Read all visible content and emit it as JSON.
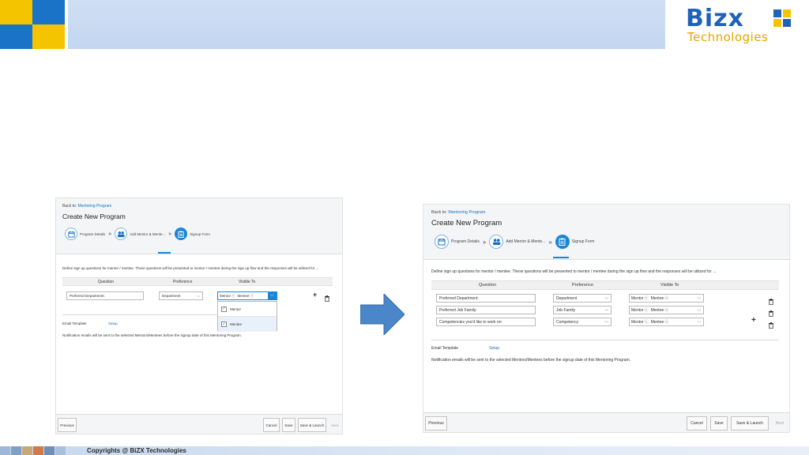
{
  "brand": {
    "name": "Bizx",
    "tagline": "Technologies"
  },
  "footer": {
    "copyright": "Copyrights @ BiZX Technologies"
  },
  "colors": {
    "accent": "#1a86d6",
    "link": "#1a6fbf",
    "brand_blue": "#1f63b8",
    "brand_yellow": "#f5c400",
    "arrow": "#4a86c8"
  },
  "left_screen": {
    "back_label": "Back to:",
    "back_link": "Mentoring Program",
    "title": "Create New Program",
    "steps": [
      {
        "label": "Program Details",
        "icon": "calendar-icon"
      },
      {
        "label": "Add Mentor & Mente...",
        "icon": "users-icon"
      },
      {
        "label": "Signup Form",
        "icon": "clipboard-icon"
      }
    ],
    "description": "Define sign up questions for mentor / mentee. These questions will be presented to mentor / mentee during the sign up flow and the responses will be utilized for ...",
    "headers": {
      "question": "Question",
      "preference": "Preference",
      "visible_to": "Visible To"
    },
    "rows": [
      {
        "question": "Preferred Department:",
        "preference": "Department",
        "visible": [
          "Mentor",
          "Mentee"
        ]
      }
    ],
    "dropdown_options": [
      "Mentor",
      "Mentee"
    ],
    "email_template_label": "Email Template",
    "setup_link": "Setup",
    "notification": "Notification emails will be sent to the selected Mentors/Mentees before the signup date of this Mentoring Program.",
    "buttons": {
      "previous": "Previous",
      "cancel": "Cancel",
      "save": "Save",
      "save_launch": "Save & Launch",
      "next": "Next"
    }
  },
  "right_screen": {
    "back_label": "Back to:",
    "back_link": "Mentoring Program",
    "title": "Create New Program",
    "steps": [
      {
        "label": "Program Details",
        "icon": "calendar-icon"
      },
      {
        "label": "Add Mentor & Mente...",
        "icon": "users-icon"
      },
      {
        "label": "Signup Form",
        "icon": "clipboard-icon"
      }
    ],
    "description": "Define sign up questions for mentor / mentee. These questions will be presented to mentor / mentee during the sign up flow and the responses will be utilized for ...",
    "headers": {
      "question": "Question",
      "preference": "Preference",
      "visible_to": "Visible To"
    },
    "rows": [
      {
        "question": "Preferred Department:",
        "preference": "Department",
        "visible": [
          "Mentor",
          "Mentee"
        ]
      },
      {
        "question": "Preferred Job Family:",
        "preference": "Job Family",
        "visible": [
          "Mentor",
          "Mentee"
        ]
      },
      {
        "question": "Competencies you'd like to work on:",
        "preference": "Competency",
        "visible": [
          "Mentor",
          "Mentee"
        ]
      }
    ],
    "email_template_label": "Email Template",
    "setup_link": "Setup",
    "notification": "Notification emails will be sent to the selected Mentors/Mentees before the signup date of this Mentoring Program.",
    "buttons": {
      "previous": "Previous",
      "cancel": "Cancel",
      "save": "Save",
      "save_launch": "Save & Launch",
      "next": "Next"
    }
  },
  "icons": {
    "add": "plus-icon",
    "delete": "trash-icon",
    "remove_token": "close-icon",
    "expand": "chevron-down-icon",
    "step_separator": "double-chevron-icon",
    "transition": "arrow-right-icon"
  }
}
